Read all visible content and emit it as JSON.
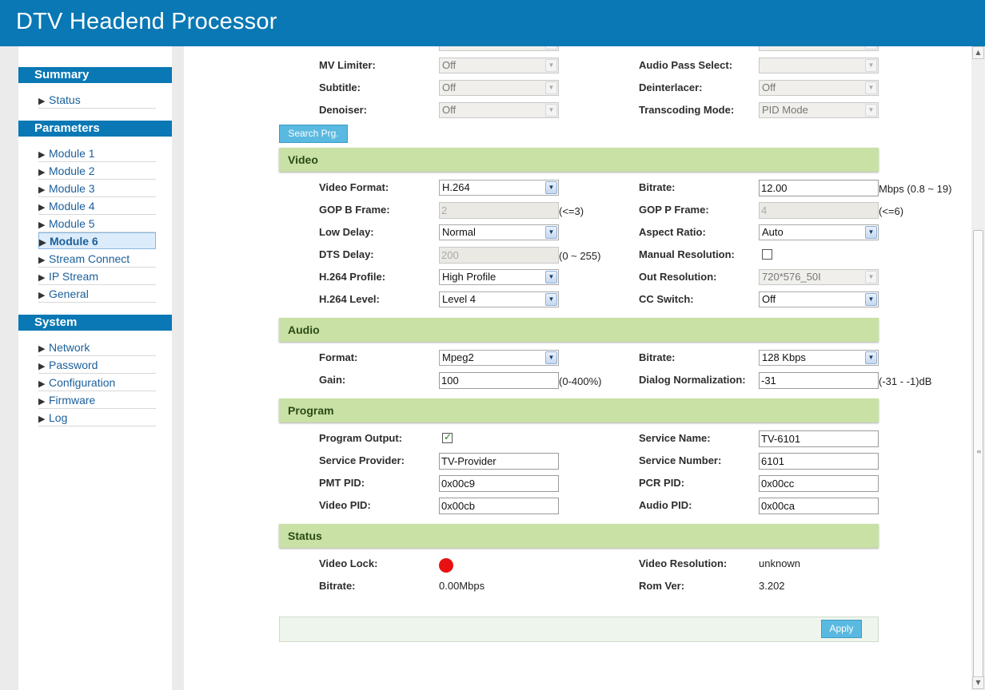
{
  "header": {
    "title": "DTV Headend Processor"
  },
  "sidebar": {
    "sections": [
      {
        "title": "Summary",
        "items": [
          "Status"
        ]
      },
      {
        "title": "Parameters",
        "items": [
          "Module 1",
          "Module 2",
          "Module 3",
          "Module 4",
          "Module 5",
          "Module 6",
          "Stream Connect",
          "IP Stream",
          "General"
        ]
      },
      {
        "title": "System",
        "items": [
          "Network",
          "Password",
          "Configuration",
          "Firmware",
          "Log"
        ]
      }
    ],
    "active_item": "Module 6"
  },
  "top": {
    "mv_limiter": {
      "label": "MV Limiter:",
      "value": "Off"
    },
    "subtitle": {
      "label": "Subtitle:",
      "value": "Off"
    },
    "denoiser": {
      "label": "Denoiser:",
      "value": "Off"
    },
    "audio_pass_select": {
      "label": "Audio Pass Select:",
      "value": ""
    },
    "deinterlacer": {
      "label": "Deinterlacer:",
      "value": "Off"
    },
    "transcoding_mode": {
      "label": "Transcoding Mode:",
      "value": "PID Mode"
    },
    "search_button": "Search Prg."
  },
  "video": {
    "title": "Video",
    "video_format": {
      "label": "Video Format:",
      "value": "H.264"
    },
    "gop_b_frame": {
      "label": "GOP B Frame:",
      "value": "2",
      "unit": "(<=3)"
    },
    "low_delay": {
      "label": "Low Delay:",
      "value": "Normal"
    },
    "dts_delay": {
      "label": "DTS Delay:",
      "value": "200",
      "unit": "(0 ~ 255)"
    },
    "h264_profile": {
      "label": "H.264 Profile:",
      "value": "High Profile"
    },
    "h264_level": {
      "label": "H.264 Level:",
      "value": "Level 4"
    },
    "bitrate": {
      "label": "Bitrate:",
      "value": "12.00",
      "unit": "Mbps (0.8 ~ 19)"
    },
    "gop_p_frame": {
      "label": "GOP P Frame:",
      "value": "4",
      "unit": "(<=6)"
    },
    "aspect_ratio": {
      "label": "Aspect Ratio:",
      "value": "Auto"
    },
    "manual_resolution": {
      "label": "Manual Resolution:",
      "checked": false
    },
    "out_resolution": {
      "label": "Out Resolution:",
      "value": "720*576_50I"
    },
    "cc_switch": {
      "label": "CC Switch:",
      "value": "Off"
    }
  },
  "audio": {
    "title": "Audio",
    "format": {
      "label": "Format:",
      "value": "Mpeg2"
    },
    "gain": {
      "label": "Gain:",
      "value": "100",
      "unit": "(0-400%)"
    },
    "bitrate": {
      "label": "Bitrate:",
      "value": "128 Kbps"
    },
    "dialog_normalization": {
      "label": "Dialog Normalization:",
      "value": "-31",
      "unit": "(-31 - -1)dB"
    }
  },
  "program": {
    "title": "Program",
    "program_output": {
      "label": "Program Output:",
      "checked": true
    },
    "service_provider": {
      "label": "Service Provider:",
      "value": "TV-Provider"
    },
    "pmt_pid": {
      "label": "PMT PID:",
      "value": "0x00c9"
    },
    "video_pid": {
      "label": "Video PID:",
      "value": "0x00cb"
    },
    "service_name": {
      "label": "Service Name:",
      "value": "TV-6101"
    },
    "service_number": {
      "label": "Service Number:",
      "value": "6101"
    },
    "pcr_pid": {
      "label": "PCR PID:",
      "value": "0x00cc"
    },
    "audio_pid": {
      "label": "Audio PID:",
      "value": "0x00ca"
    }
  },
  "status": {
    "title": "Status",
    "video_lock": {
      "label": "Video Lock:",
      "color": "#e81010"
    },
    "bitrate": {
      "label": "Bitrate:",
      "value": "0.00Mbps"
    },
    "video_resolution": {
      "label": "Video Resolution:",
      "value": "unknown"
    },
    "rom_ver": {
      "label": "Rom Ver:",
      "value": "3.202"
    }
  },
  "apply_button": "Apply"
}
